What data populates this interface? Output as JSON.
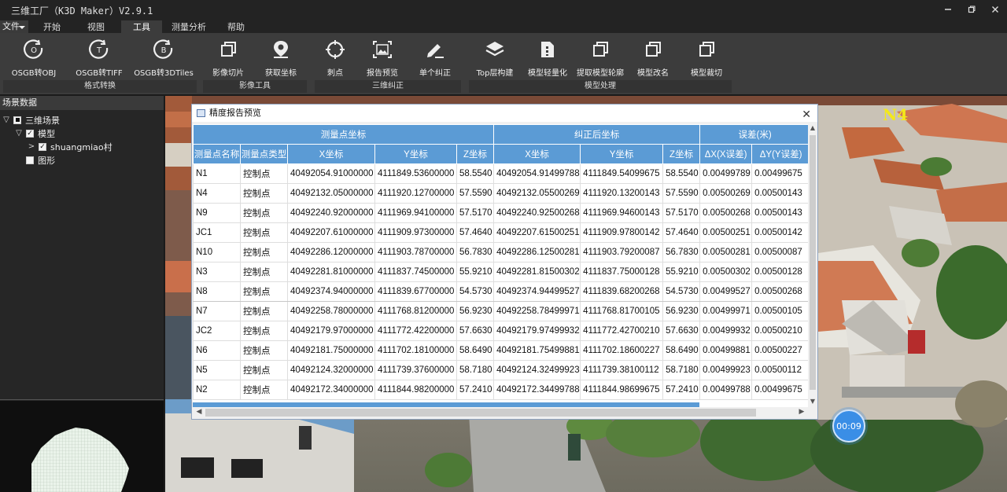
{
  "window": {
    "title": "三维工厂（K3D Maker）V2.9.1",
    "minimize_icon": "minimize-icon",
    "restore_icon": "restore-icon",
    "close_icon": "close-icon"
  },
  "menu": {
    "file_label": "文件",
    "tabs": [
      {
        "label": "开始"
      },
      {
        "label": "视图"
      },
      {
        "label": "工具",
        "active": true
      },
      {
        "label": "测量分析"
      },
      {
        "label": "帮助"
      }
    ]
  },
  "ribbon": {
    "buttons": [
      {
        "label": "OSGB转OBJ",
        "icon": "osgb-obj-icon"
      },
      {
        "label": "OSGB转TIFF",
        "icon": "osgb-tiff-icon"
      },
      {
        "label": "OSGB转3DTiles",
        "icon": "osgb-3dtiles-icon"
      },
      {
        "label": "影像切片",
        "icon": "image-slice-icon"
      },
      {
        "label": "获取坐标",
        "icon": "location-pin-icon"
      },
      {
        "label": "刺点",
        "icon": "crosshair-icon"
      },
      {
        "label": "报告预览",
        "icon": "report-preview-icon"
      },
      {
        "label": "单个纠正",
        "icon": "pen-icon"
      },
      {
        "label": "Top层构建",
        "icon": "layers-icon"
      },
      {
        "label": "模型轻量化",
        "icon": "lightweight-icon"
      },
      {
        "label": "提取模型轮廓",
        "icon": "outline-icon"
      },
      {
        "label": "模型改名",
        "icon": "rename-icon"
      },
      {
        "label": "模型裁切",
        "icon": "crop-icon"
      }
    ],
    "groups": [
      {
        "label": "格式转换"
      },
      {
        "label": "影像工具"
      },
      {
        "label": "三维纠正"
      },
      {
        "label": "模型处理"
      }
    ]
  },
  "scene_panel": {
    "title": "场景数据",
    "tree": [
      {
        "label": "三维场景",
        "expander": "▽",
        "check": "partial"
      },
      {
        "label": "模型",
        "expander": "▽",
        "check": "checked"
      },
      {
        "label": "shuangmiao村",
        "expander": ">",
        "check": "checked"
      },
      {
        "label": "图形",
        "expander": "",
        "check": "unchecked"
      }
    ]
  },
  "viewport": {
    "label": "N4",
    "timer": "00:09"
  },
  "dialog": {
    "title": "精度报告预览",
    "group_headers": [
      "测量点坐标",
      "纠正后坐标",
      "误差(米)"
    ],
    "columns": [
      "测量点名称",
      "测量点类型",
      "X坐标",
      "Y坐标",
      "Z坐标",
      "X坐标",
      "Y坐标",
      "Z坐标",
      "ΔX(X误差)",
      "ΔY(Y误差)"
    ],
    "rows": [
      [
        "N1",
        "控制点",
        "40492054.91000000",
        "4111849.53600000",
        "58.5540",
        "40492054.91499788",
        "4111849.54099675",
        "58.5540",
        "0.00499789",
        "0.00499675"
      ],
      [
        "N4",
        "控制点",
        "40492132.05000000",
        "4111920.12700000",
        "57.5590",
        "40492132.05500269",
        "4111920.13200143",
        "57.5590",
        "0.00500269",
        "0.00500143"
      ],
      [
        "N9",
        "控制点",
        "40492240.92000000",
        "4111969.94100000",
        "57.5170",
        "40492240.92500268",
        "4111969.94600143",
        "57.5170",
        "0.00500268",
        "0.00500143"
      ],
      [
        "JC1",
        "控制点",
        "40492207.61000000",
        "4111909.97300000",
        "57.4640",
        "40492207.61500251",
        "4111909.97800142",
        "57.4640",
        "0.00500251",
        "0.00500142"
      ],
      [
        "N10",
        "控制点",
        "40492286.12000000",
        "4111903.78700000",
        "56.7830",
        "40492286.12500281",
        "4111903.79200087",
        "56.7830",
        "0.00500281",
        "0.00500087"
      ],
      [
        "N3",
        "控制点",
        "40492281.81000000",
        "4111837.74500000",
        "55.9210",
        "40492281.81500302",
        "4111837.75000128",
        "55.9210",
        "0.00500302",
        "0.00500128"
      ],
      [
        "N8",
        "控制点",
        "40492374.94000000",
        "4111839.67700000",
        "54.5730",
        "40492374.94499527",
        "4111839.68200268",
        "54.5730",
        "0.00499527",
        "0.00500268"
      ],
      [
        "N7",
        "控制点",
        "40492258.78000000",
        "4111768.81200000",
        "56.9230",
        "40492258.78499971",
        "4111768.81700105",
        "56.9230",
        "0.00499971",
        "0.00500105"
      ],
      [
        "JC2",
        "控制点",
        "40492179.97000000",
        "4111772.42200000",
        "57.6630",
        "40492179.97499932",
        "4111772.42700210",
        "57.6630",
        "0.00499932",
        "0.00500210"
      ],
      [
        "N6",
        "控制点",
        "40492181.75000000",
        "4111702.18100000",
        "58.6490",
        "40492181.75499881",
        "4111702.18600227",
        "58.6490",
        "0.00499881",
        "0.00500227"
      ],
      [
        "N5",
        "控制点",
        "40492124.32000000",
        "4111739.37600000",
        "58.7180",
        "40492124.32499923",
        "4111739.38100112",
        "58.7180",
        "0.00499923",
        "0.00500112"
      ],
      [
        "N2",
        "控制点",
        "40492172.34000000",
        "4111844.98200000",
        "57.2410",
        "40492172.34499788",
        "4111844.98699675",
        "57.2410",
        "0.00499788",
        "0.00499675"
      ]
    ]
  }
}
